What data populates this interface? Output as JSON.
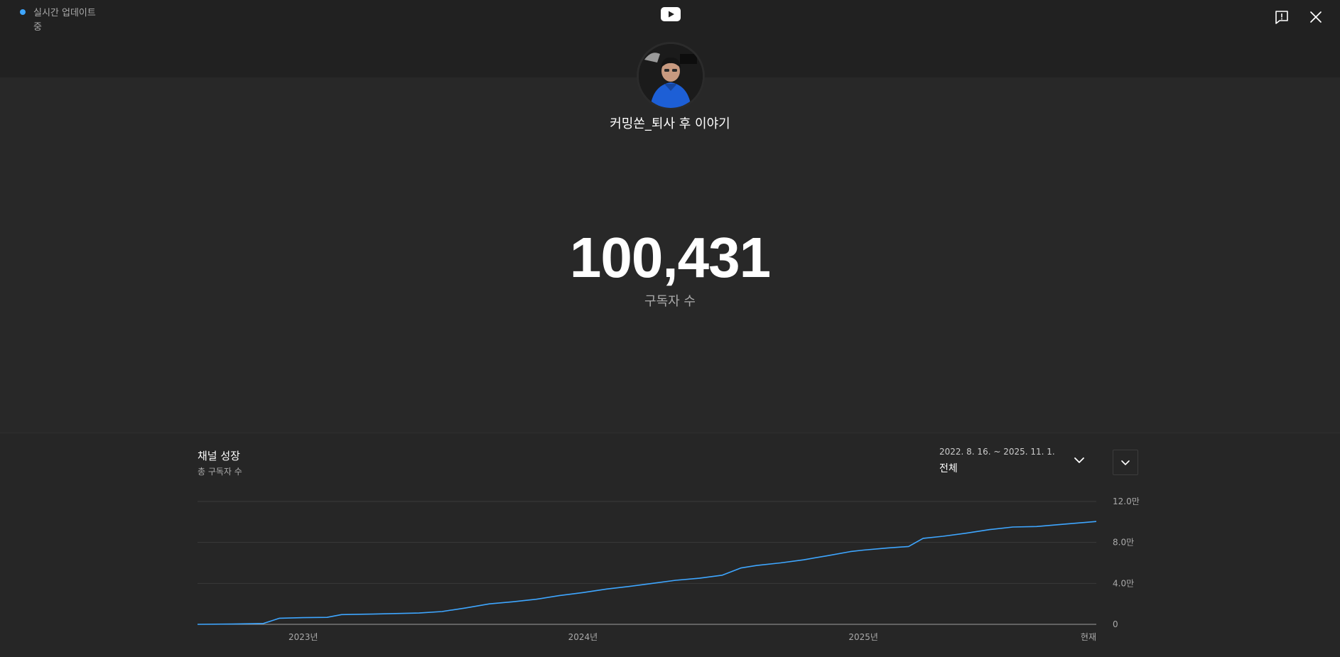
{
  "live": {
    "label": "실시간 업데이트 중",
    "dot_color": "#3ea6ff"
  },
  "icons": {
    "logo": "youtube-logo-icon",
    "feedback": "feedback-icon",
    "close": "close-icon",
    "range_chevron": "chevron-down-icon",
    "menu_chevron": "chevron-down-icon"
  },
  "channel": {
    "name": "커밍쏜_퇴사 후 이야기"
  },
  "stats": {
    "subscriber_count": "100,431",
    "subscriber_label": "구독자 수"
  },
  "chart_section": {
    "title": "채널 성장",
    "subtitle": "총 구독자 수",
    "range_dates": "2022. 8. 16. ~ 2025. 11. 1.",
    "range_value": "전체"
  },
  "colors": {
    "accent": "#3ea6ff",
    "background": "#282828",
    "topbar": "#212121"
  },
  "chart_data": {
    "type": "line",
    "title": "채널 성장",
    "subtitle": "총 구독자 수",
    "x_range": [
      "2022-08-16",
      "2025-11-01"
    ],
    "x_ticks": [
      {
        "label": "2023년",
        "date": "2023-01-01"
      },
      {
        "label": "2024년",
        "date": "2024-01-01"
      },
      {
        "label": "2025년",
        "date": "2025-01-01"
      },
      {
        "label": "현재",
        "date": "2025-11-01"
      }
    ],
    "y_ticks": [
      {
        "label": "0",
        "value": 0
      },
      {
        "label": "4.0만",
        "value": 40000
      },
      {
        "label": "8.0만",
        "value": 80000
      },
      {
        "label": "12.0만",
        "value": 120000
      }
    ],
    "ylim": [
      0,
      120000
    ],
    "grid": true,
    "series": [
      {
        "color": "#3ea6ff",
        "points": [
          [
            "2022-08-16",
            0
          ],
          [
            "2022-10-01",
            300
          ],
          [
            "2022-11-10",
            800
          ],
          [
            "2022-12-01",
            6000
          ],
          [
            "2023-01-01",
            6500
          ],
          [
            "2023-02-01",
            6800
          ],
          [
            "2023-02-20",
            9500
          ],
          [
            "2023-04-01",
            10000
          ],
          [
            "2023-06-01",
            11000
          ],
          [
            "2023-07-01",
            12500
          ],
          [
            "2023-08-01",
            16000
          ],
          [
            "2023-09-01",
            20000
          ],
          [
            "2023-10-01",
            22000
          ],
          [
            "2023-11-01",
            24500
          ],
          [
            "2023-12-01",
            28000
          ],
          [
            "2024-01-01",
            31000
          ],
          [
            "2024-02-01",
            34500
          ],
          [
            "2024-03-01",
            37000
          ],
          [
            "2024-04-01",
            40000
          ],
          [
            "2024-05-01",
            43000
          ],
          [
            "2024-06-01",
            45000
          ],
          [
            "2024-07-01",
            48000
          ],
          [
            "2024-07-25",
            55000
          ],
          [
            "2024-08-15",
            57500
          ],
          [
            "2024-09-15",
            60000
          ],
          [
            "2024-10-15",
            63000
          ],
          [
            "2024-11-15",
            67000
          ],
          [
            "2024-12-15",
            71000
          ],
          [
            "2025-01-01",
            72500
          ],
          [
            "2025-02-01",
            74500
          ],
          [
            "2025-03-01",
            76000
          ],
          [
            "2025-03-20",
            84000
          ],
          [
            "2025-04-15",
            86000
          ],
          [
            "2025-05-15",
            89000
          ],
          [
            "2025-06-15",
            92500
          ],
          [
            "2025-07-15",
            95000
          ],
          [
            "2025-08-15",
            95500
          ],
          [
            "2025-09-15",
            97500
          ],
          [
            "2025-11-01",
            100431
          ]
        ]
      }
    ]
  }
}
